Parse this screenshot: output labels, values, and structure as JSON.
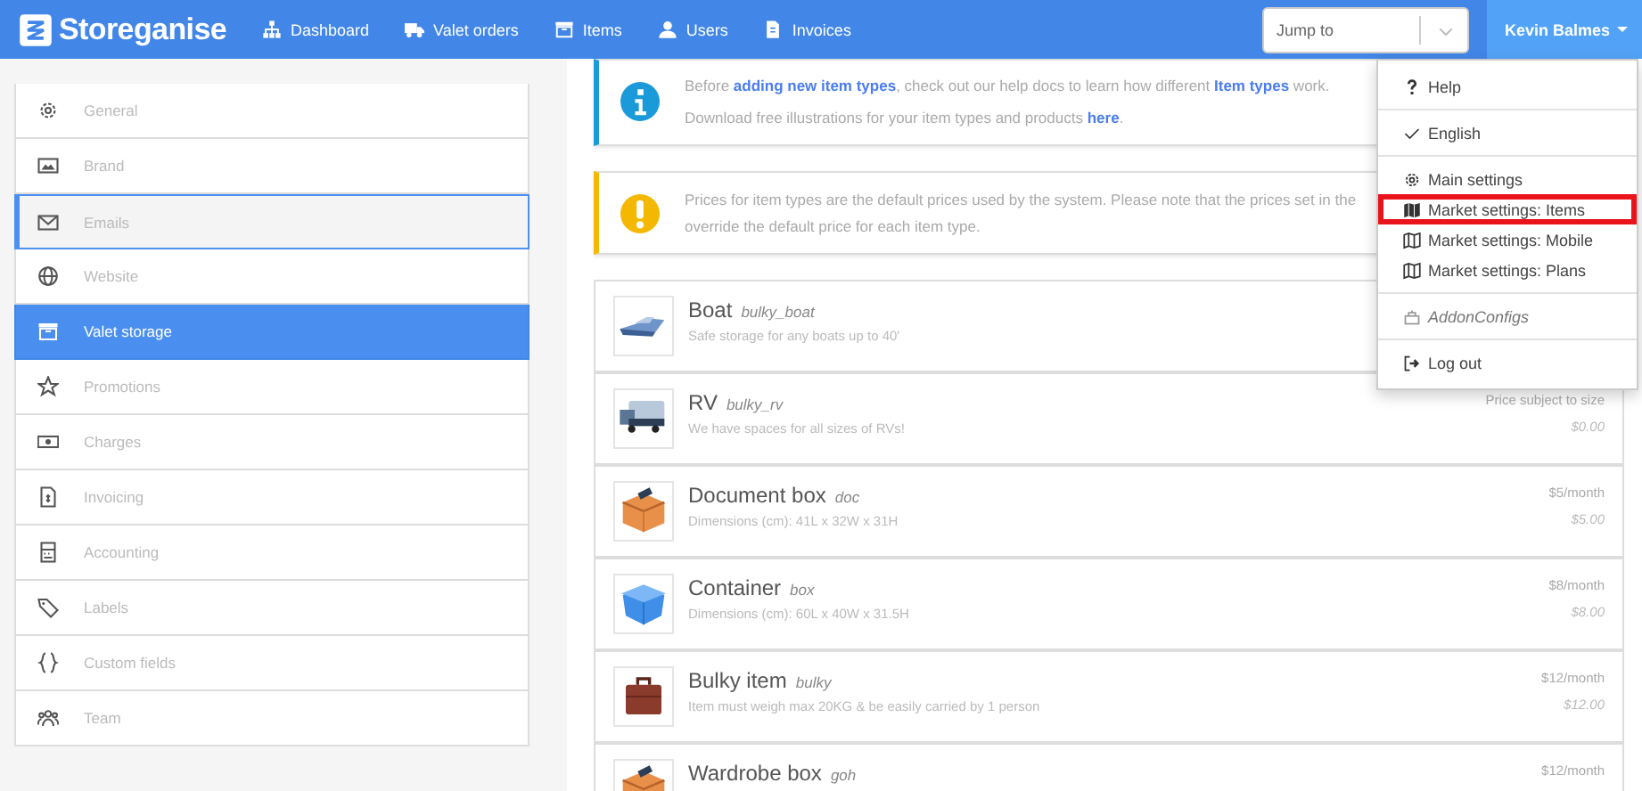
{
  "navbar": {
    "brand": "Storeganise",
    "links": [
      {
        "label": "Dashboard",
        "kind": "sitemap"
      },
      {
        "label": "Valet orders",
        "kind": "truck"
      },
      {
        "label": "Items",
        "kind": "archive"
      },
      {
        "label": "Users",
        "kind": "user"
      },
      {
        "label": "Invoices",
        "kind": "file"
      }
    ],
    "jump": {
      "placeholder": "Jump to"
    },
    "user": {
      "label": "Kevin Balmes",
      "expanded": true
    }
  },
  "sidebar": {
    "items": [
      {
        "label": "General",
        "kind": "gear",
        "selected": false,
        "focused": false
      },
      {
        "label": "Brand",
        "kind": "image",
        "selected": false,
        "focused": false
      },
      {
        "label": "Emails",
        "kind": "mail",
        "selected": false,
        "focused": true
      },
      {
        "label": "Website",
        "kind": "globe",
        "selected": false,
        "focused": false
      },
      {
        "label": "Valet storage",
        "kind": "archive",
        "selected": true,
        "focused": false
      },
      {
        "label": "Promotions",
        "kind": "star",
        "selected": false,
        "focused": false
      },
      {
        "label": "Charges",
        "kind": "money",
        "selected": false,
        "focused": false
      },
      {
        "label": "Invoicing",
        "kind": "invoice",
        "selected": false,
        "focused": false
      },
      {
        "label": "Accounting",
        "kind": "calc",
        "selected": false,
        "focused": false
      },
      {
        "label": "Labels",
        "kind": "tags",
        "selected": false,
        "focused": false
      },
      {
        "label": "Custom fields",
        "kind": "braces",
        "selected": false,
        "focused": false
      },
      {
        "label": "Team",
        "kind": "team",
        "selected": false,
        "focused": false
      }
    ]
  },
  "notices": [
    {
      "kind": "info",
      "lines": [
        [
          {
            "text": "Before "
          },
          {
            "text": "adding new item types",
            "link": true
          },
          {
            "text": ", check out our help docs to learn how different "
          },
          {
            "text": "Item types",
            "link": true
          },
          {
            "text": " work."
          }
        ],
        [
          {
            "text": "Download free illustrations for your item types and products "
          },
          {
            "text": "here",
            "link": true
          },
          {
            "text": "."
          }
        ]
      ]
    },
    {
      "kind": "warning",
      "lines": [
        [
          {
            "text": "Prices for item types are the default prices used by the system. Please note that the prices set in the"
          }
        ],
        [
          {
            "text": "override the default price for each item type."
          }
        ]
      ]
    }
  ],
  "item_types": [
    {
      "name": "Boat",
      "code": "bulky_boat",
      "description": "Safe storage for any boats up to 40'",
      "kind": "boat"
    },
    {
      "name": "RV",
      "code": "bulky_rv",
      "description": "We have spaces for all sizes of RVs!",
      "kind": "rv",
      "price_note": "Price subject to size",
      "price": "$0.00"
    },
    {
      "name": "Document box",
      "code": "doc",
      "description": "Dimensions (cm): 41L x 32W x 31H",
      "kind": "box",
      "price_note": "$5/month",
      "price": "$5.00"
    },
    {
      "name": "Container",
      "code": "box",
      "description": "Dimensions (cm): 60L x 40W x 31.5H",
      "kind": "container",
      "price_note": "$8/month",
      "price": "$8.00"
    },
    {
      "name": "Bulky item",
      "code": "bulky",
      "description": "Item must weigh max 20KG & be easily carried by 1 person",
      "kind": "suitcase",
      "price_note": "$12/month",
      "price": "$12.00"
    },
    {
      "name": "Wardrobe box",
      "code": "goh",
      "kind": "box",
      "price_note": "$12/month"
    }
  ],
  "user_menu": {
    "groups": [
      [
        {
          "label": "Help",
          "kind": "question",
          "highlighted": false
        }
      ],
      [
        {
          "label": "English",
          "kind": "check",
          "highlighted": false
        }
      ],
      [
        {
          "label": "Main settings",
          "kind": "gear",
          "highlighted": false
        },
        {
          "label": "Market settings: Items",
          "kind": "map",
          "highlighted": true
        },
        {
          "label": "Market settings: Mobile",
          "kind": "map-outline",
          "highlighted": false
        },
        {
          "label": "Market settings: Plans",
          "kind": "map-outline",
          "highlighted": false
        }
      ],
      [
        {
          "label": "AddonConfigs",
          "kind": "addon",
          "highlighted": false
        }
      ],
      [
        {
          "label": "Log out",
          "kind": "logout",
          "highlighted": false
        }
      ]
    ]
  }
}
